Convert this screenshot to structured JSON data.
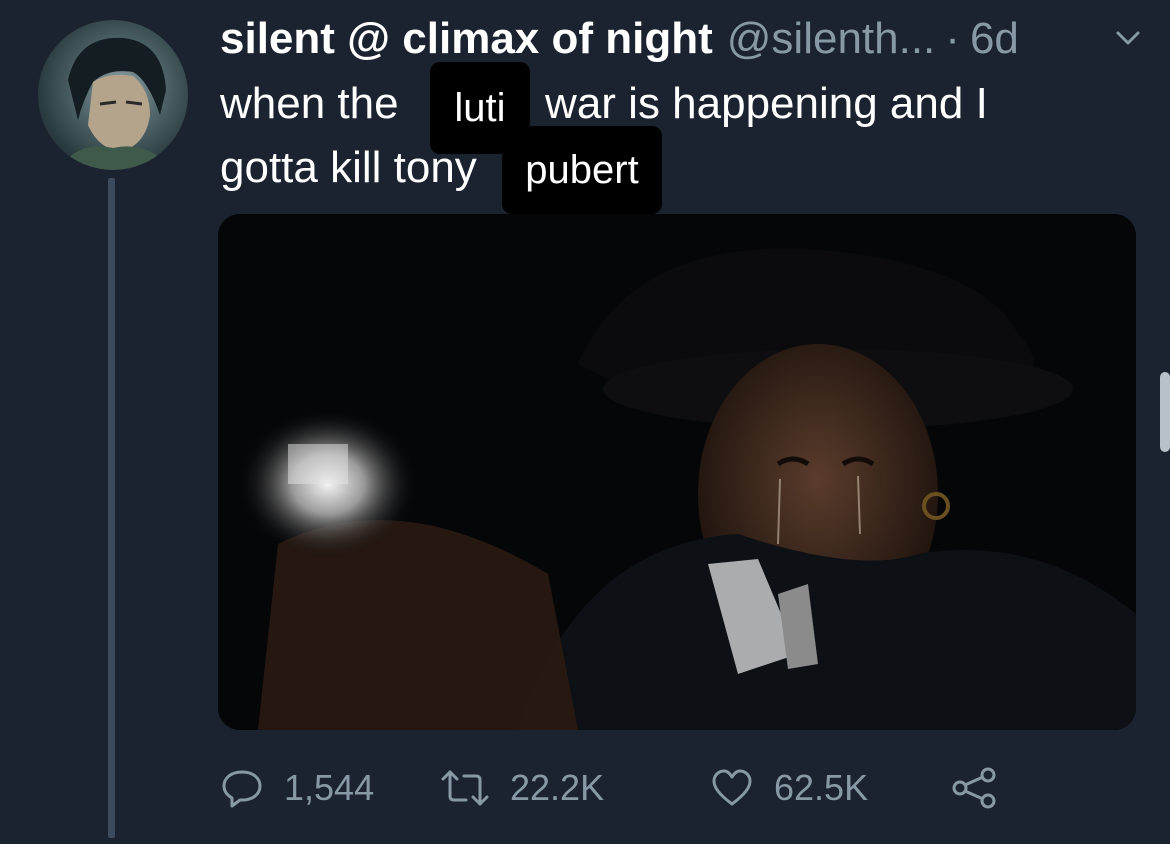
{
  "tweet": {
    "display_name": "silent @ climax of night",
    "handle": "@silenth...",
    "separator": "·",
    "timestamp": "6d",
    "text_line1_before": "when the",
    "text_line1_after": "war is happening and I",
    "text_line2": "gotta kill tony"
  },
  "overlays": {
    "word1": "luti",
    "word2": "pubert"
  },
  "actions": {
    "replies": "1,544",
    "retweets": "22.2K",
    "likes": "62.5K"
  },
  "colors": {
    "background": "#1c2330",
    "secondary_text": "#8899a6",
    "thread_line": "#3b4a5c"
  },
  "icons": [
    "avatar",
    "chevron-down-icon",
    "reply-icon",
    "retweet-icon",
    "like-icon",
    "share-icon"
  ]
}
